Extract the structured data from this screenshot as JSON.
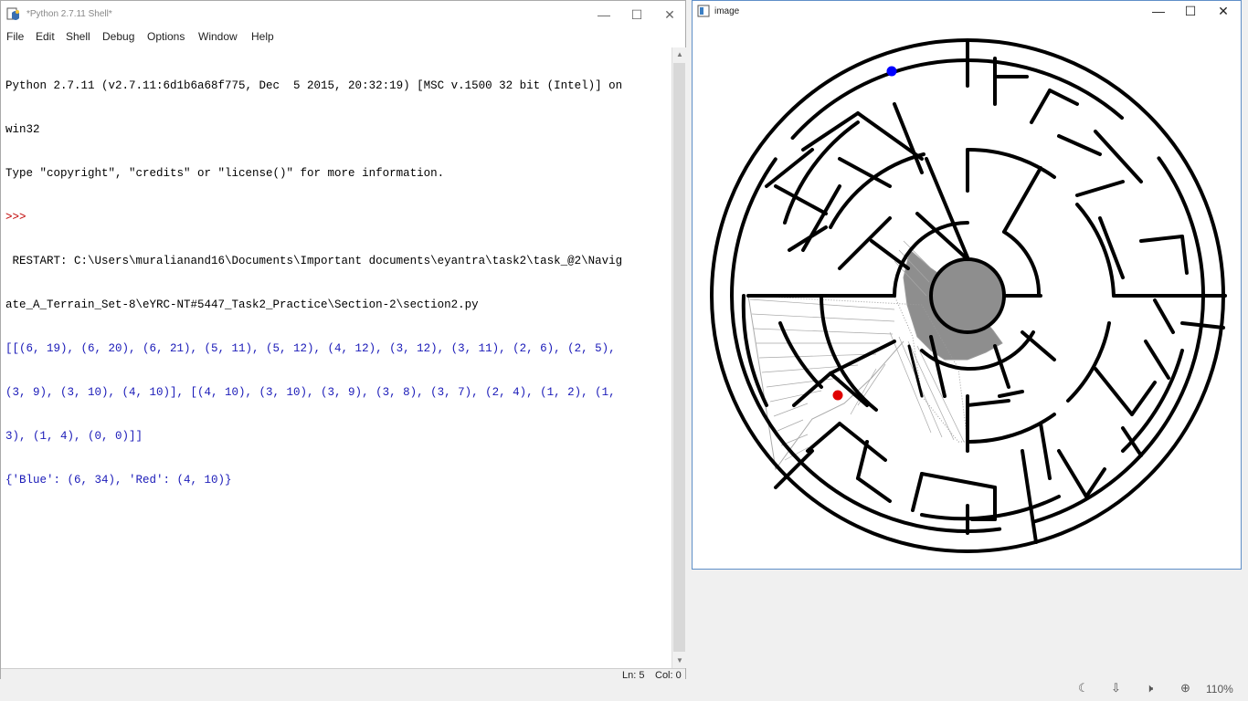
{
  "shell": {
    "title": "*Python 2.7.11 Shell*",
    "menu": [
      "File",
      "Edit",
      "Shell",
      "Debug",
      "Options",
      "Window",
      "Help"
    ],
    "lines": [
      {
        "text": "Python 2.7.11 (v2.7.11:6d1b6a68f775, Dec  5 2015, 20:32:19) [MSC v.1500 32 bit (Intel)] on",
        "style": "black"
      },
      {
        "text": "win32",
        "style": "black"
      },
      {
        "text": "Type \"copyright\", \"credits\" or \"license()\" for more information.",
        "style": "black"
      },
      {
        "text": ">>> ",
        "style": "red"
      },
      {
        "text": " RESTART: C:\\Users\\muralianand16\\Documents\\Important documents\\eyantra\\task2\\task_@2\\Navig",
        "style": "black"
      },
      {
        "text": "ate_A_Terrain_Set-8\\eYRC-NT#5447_Task2_Practice\\Section-2\\section2.py",
        "style": "black"
      },
      {
        "text": "[[(6, 19), (6, 20), (6, 21), (5, 11), (5, 12), (4, 12), (3, 12), (3, 11), (2, 6), (2, 5),",
        "style": "blue"
      },
      {
        "text": "(3, 9), (3, 10), (4, 10)], [(4, 10), (3, 10), (3, 9), (3, 8), (3, 7), (2, 4), (1, 2), (1,",
        "style": "blue"
      },
      {
        "text": "3), (1, 4), (0, 0)]]",
        "style": "blue"
      },
      {
        "text": "{'Blue': (6, 34), 'Red': (4, 10)}",
        "style": "blue"
      }
    ],
    "status": {
      "ln": "Ln: 5",
      "col": "Col: 0"
    },
    "controls": {
      "minimize": "—",
      "maximize": "☐",
      "close": "✕"
    }
  },
  "image_window": {
    "title": "image",
    "controls": {
      "minimize": "—",
      "maximize": "☐",
      "close": "✕"
    },
    "markers": {
      "blue": "#0000ff",
      "red": "#e00000"
    }
  },
  "taskbar": {
    "icons": [
      "moon-icon",
      "network-icon",
      "volume-icon",
      "zoom-icon"
    ],
    "zoom": "110%"
  }
}
